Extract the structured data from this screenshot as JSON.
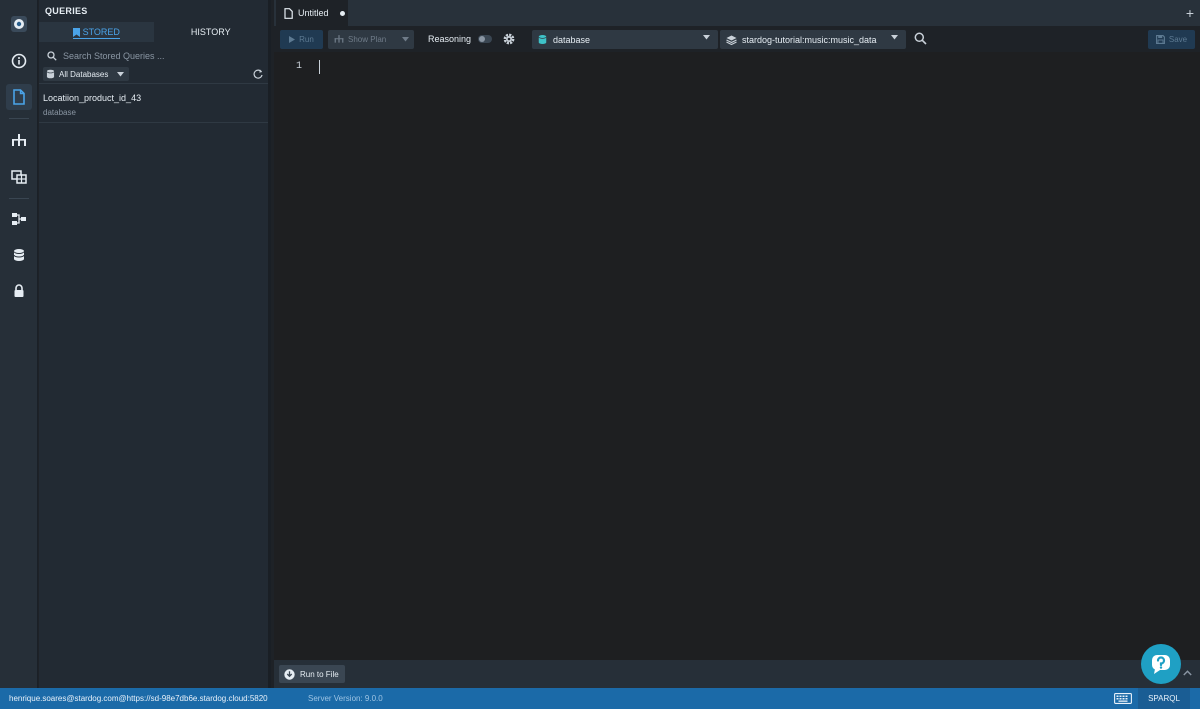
{
  "queries_panel": {
    "title": "QUERIES",
    "tabs": [
      {
        "label": "STORED",
        "active": true
      },
      {
        "label": "HISTORY",
        "active": false
      }
    ],
    "search": {
      "placeholder": "Search Stored Queries ..."
    },
    "db_filter": {
      "label": "All Databases"
    },
    "items": [
      {
        "name": "Locatiion_product_id_43",
        "database": "database"
      }
    ]
  },
  "editor": {
    "tab": {
      "title": "Untitled",
      "unsaved": true
    },
    "toolbar": {
      "run_label": "Run",
      "show_plan_label": "Show Plan",
      "reasoning_label": "Reasoning",
      "reasoning_on": false,
      "database": "database",
      "graph": "stardog-tutorial:music:music_data",
      "save_label": "Save"
    },
    "lines": [
      "1"
    ],
    "run_to_file_label": "Run to File"
  },
  "status_bar": {
    "connection": "henrique.soares@stardog.com@https://sd-98e7db6e.stardog.cloud:5820",
    "server_version": "Server Version: 9.0.0",
    "mode": "SPARQL"
  },
  "colors": {
    "accent": "#4aa3e8",
    "status_bar": "#1b6aa8",
    "help_button": "#1fa0c4",
    "database_icon": "#3ec2c8"
  }
}
